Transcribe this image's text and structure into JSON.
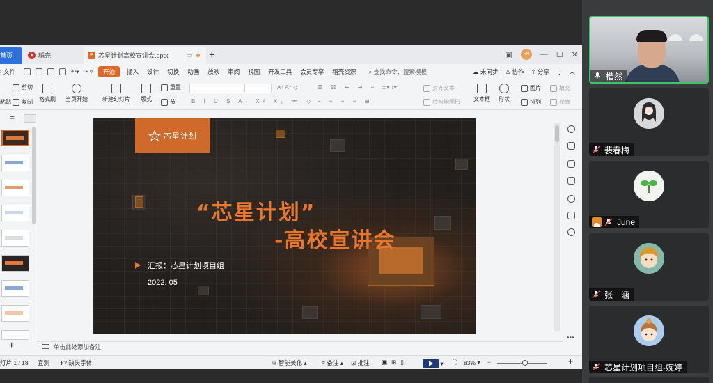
{
  "titlebar": {
    "tabs": [
      {
        "label": "首页"
      },
      {
        "label": "稻壳"
      },
      {
        "label": "芯星计划高校宣讲会.pptx"
      }
    ],
    "user_initials": "FN"
  },
  "menu": {
    "file": "文件",
    "items": [
      "开始",
      "插入",
      "设计",
      "切换",
      "动画",
      "放映",
      "审阅",
      "视图",
      "开发工具",
      "会员专享",
      "稻壳资源"
    ],
    "search": "查找命令、搜索模板",
    "sync": "未同步",
    "collab": "协作",
    "share": "分享"
  },
  "toolbar": {
    "cut": "剪切",
    "paste": "粘贴",
    "copy": "复制",
    "format_painter": "格式刷",
    "from_current": "当页开始",
    "new_slide": "新建幻灯片",
    "layout": "版式",
    "section": "节",
    "reset": "重置",
    "align_text": "对齐文本",
    "smart_graphic": "转智能图形",
    "textbox": "文本框",
    "shape": "形状",
    "image": "图片",
    "arrange": "排列",
    "fill": "填充",
    "outline": "轮廓"
  },
  "slide": {
    "logo_text": "芯星计划",
    "title_line1": "“芯星计划”",
    "title_line2": "-高校宣讲会",
    "reporter": "汇报：芯星计划项目组",
    "date": "2022. 05"
  },
  "notes_placeholder": "单击此处添加备注",
  "statusbar": {
    "slide_counter": "灯片 1 / 18",
    "theme": "宜测",
    "missing_font": "缺失字体",
    "beautify": "智能美化",
    "notes": "备注",
    "comments": "批注",
    "zoom": "83%"
  },
  "participants": [
    {
      "name": "楷然"
    },
    {
      "name": "裴春梅"
    },
    {
      "name": "June"
    },
    {
      "name": "张一涵"
    },
    {
      "name": "芯星计划项目组-婉婷"
    }
  ],
  "colors": {
    "accent_orange": "#e0672a",
    "active_speaker": "#3bc46b",
    "home_tab": "#2f6fde"
  }
}
